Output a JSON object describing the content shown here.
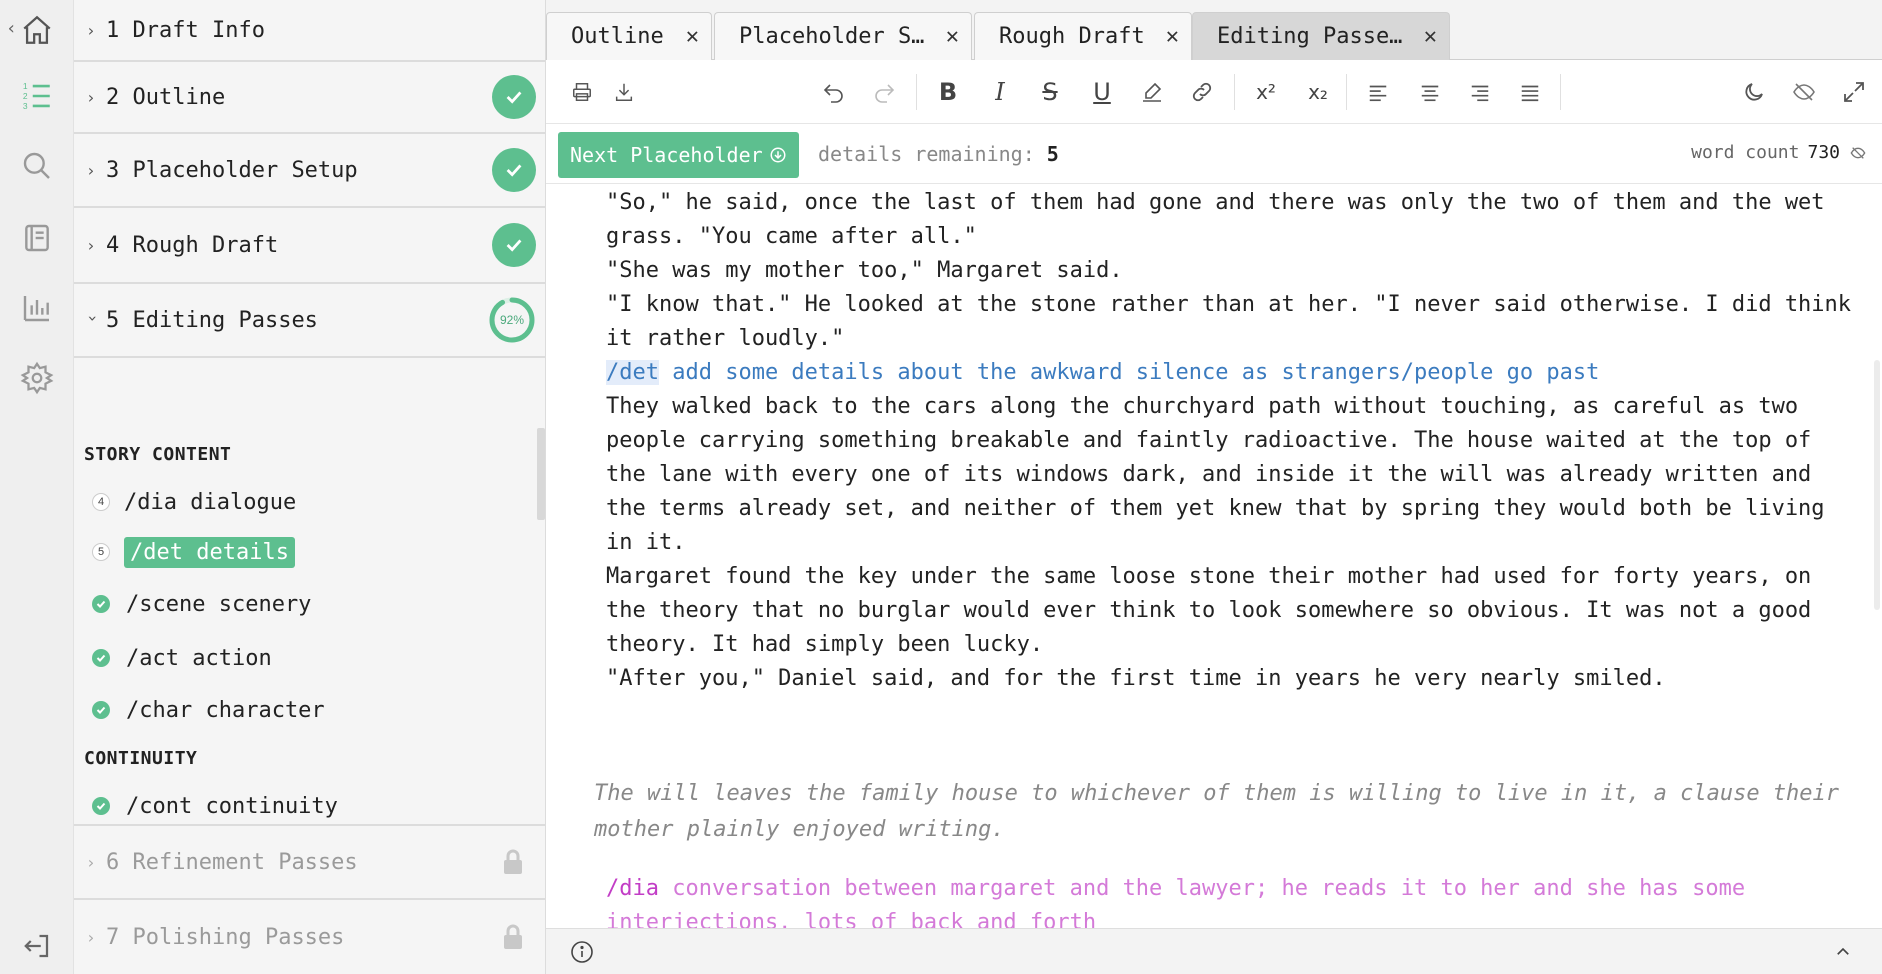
{
  "rail": {
    "icons": [
      "home-icon",
      "outline-list-icon",
      "search-icon",
      "notebook-icon",
      "stats-icon",
      "settings-icon",
      "logout-icon"
    ],
    "accent": "#5dbf8f"
  },
  "sidebar": {
    "sections": [
      {
        "num": "1",
        "title": "Draft Info",
        "status": "none"
      },
      {
        "num": "2",
        "title": "Outline",
        "status": "done"
      },
      {
        "num": "3",
        "title": "Placeholder Setup",
        "status": "done"
      },
      {
        "num": "4",
        "title": "Rough Draft",
        "status": "done"
      },
      {
        "num": "5",
        "title": "Editing Passes",
        "status": "progress",
        "progress_label": "92%",
        "progress_value": 0.92
      },
      {
        "num": "6",
        "title": "Refinement Passes",
        "status": "locked"
      },
      {
        "num": "7",
        "title": "Polishing Passes",
        "status": "locked"
      }
    ],
    "story_content_heading": "STORY CONTENT",
    "continuity_heading": "CONTINUITY",
    "story_items": [
      {
        "badge": "4",
        "label": "/dia dialogue",
        "state": "count"
      },
      {
        "badge": "5",
        "label": "/det details",
        "state": "active"
      },
      {
        "label": "/scene scenery",
        "state": "done"
      },
      {
        "label": "/act action",
        "state": "done"
      },
      {
        "label": "/char character",
        "state": "done"
      }
    ],
    "continuity_items": [
      {
        "label": "/cont continuity",
        "state": "done"
      }
    ]
  },
  "tabs": [
    {
      "label": "Outline",
      "active": false
    },
    {
      "label": "Placeholder S…",
      "active": false
    },
    {
      "label": "Rough Draft",
      "active": false
    },
    {
      "label": "Editing Passe…",
      "active": true
    }
  ],
  "toolbar": {
    "buttons": [
      "print-icon",
      "download-icon",
      "undo-icon",
      "redo-icon",
      "bold-icon",
      "italic-icon",
      "strikethrough-icon",
      "underline-icon",
      "highlighter-icon",
      "link-icon",
      "superscript-icon",
      "subscript-icon",
      "align-left-icon",
      "align-center-icon",
      "align-right-icon",
      "align-justify-icon",
      "dark-mode-icon",
      "hide-icon",
      "fullscreen-icon"
    ],
    "bold_glyph": "B",
    "italic_glyph": "I",
    "strike_glyph": "S",
    "underline_glyph": "U",
    "sup_glyph": "x²",
    "sub_glyph": "x₂"
  },
  "placeholder_bar": {
    "next_label": "Next Placeholder",
    "remaining_label": "details remaining:",
    "remaining_count": "5",
    "word_count_label": "word count",
    "word_count": "730"
  },
  "editor": {
    "lines": [
      "\"So,\" he said, once the last of them had gone and there was only the two of them and the wet grass. \"You came after all.\"",
      "\"She was my mother too,\" Margaret said.",
      "\"I know that.\" He looked at the stone rather than at her. \"I never said otherwise. I did think it rather loudly.\""
    ],
    "det_placeholder": {
      "cmd": "/det",
      "text": " add some details about the awkward silence as strangers/people go past"
    },
    "lines_after": [
      "They walked back to the cars along the churchyard path without touching, as careful as two people carrying something breakable and faintly radioactive. The house waited at the top of the lane with every one of its windows dark, and inside it the will was already written and the terms already set, and neither of them yet knew that by spring they would both be living in it.",
      "Margaret found the key under the same loose stone their mother had used for forty years, on the theory that no burglar would ever think to look somewhere so obvious. It was not a good theory. It had simply been lucky.",
      "\"After you,\" Daniel said, and for the first time in years he very nearly smiled."
    ],
    "italic_note": "The will leaves the family house to whichever of them is willing to live in it, a clause their mother plainly enjoyed writing.",
    "dia_placeholder": {
      "cmd": "/dia",
      "text": " conversation between margaret and the lawyer; he reads it to her and she has some interjections. lots of back and forth"
    }
  },
  "bottom_bar": {
    "info_icon": "info-icon",
    "collapse_icon": "chevron-up-icon"
  }
}
